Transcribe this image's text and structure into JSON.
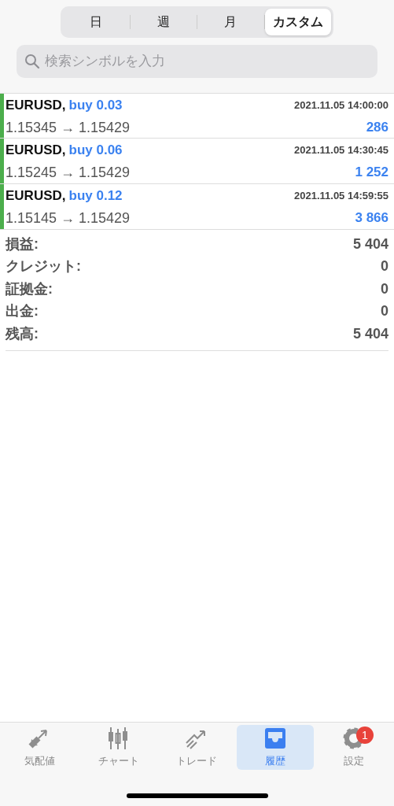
{
  "segments": [
    {
      "label": "日",
      "selected": false
    },
    {
      "label": "週",
      "selected": false
    },
    {
      "label": "月",
      "selected": false
    },
    {
      "label": "カスタム",
      "selected": true
    }
  ],
  "search": {
    "placeholder": "検索シンボルを入力"
  },
  "trades": [
    {
      "symbol": "EURUSD,",
      "order": "buy 0.03",
      "time": "2021.11.05 14:00:00",
      "prices": "1.15345 → 1.15429",
      "profit": "286"
    },
    {
      "symbol": "EURUSD,",
      "order": "buy 0.06",
      "time": "2021.11.05 14:30:45",
      "prices": "1.15245 → 1.15429",
      "profit": "1 252"
    },
    {
      "symbol": "EURUSD,",
      "order": "buy 0.12",
      "time": "2021.11.05 14:59:55",
      "prices": "1.15145 → 1.15429",
      "profit": "3 866"
    }
  ],
  "summary": [
    {
      "label": "損益:",
      "value": "5 404"
    },
    {
      "label": "クレジット:",
      "value": "0"
    },
    {
      "label": "証拠金:",
      "value": "0"
    },
    {
      "label": "出金:",
      "value": "0"
    },
    {
      "label": "残高:",
      "value": "5 404"
    }
  ],
  "tab_bar": [
    {
      "kind": "quotes",
      "label": "気配値",
      "selected": false
    },
    {
      "kind": "chart",
      "label": "チャート",
      "selected": false
    },
    {
      "kind": "trade",
      "label": "トレード",
      "selected": false
    },
    {
      "kind": "history",
      "label": "履歴",
      "selected": true
    },
    {
      "kind": "settings",
      "label": "設定",
      "selected": false,
      "badge": "1"
    }
  ]
}
